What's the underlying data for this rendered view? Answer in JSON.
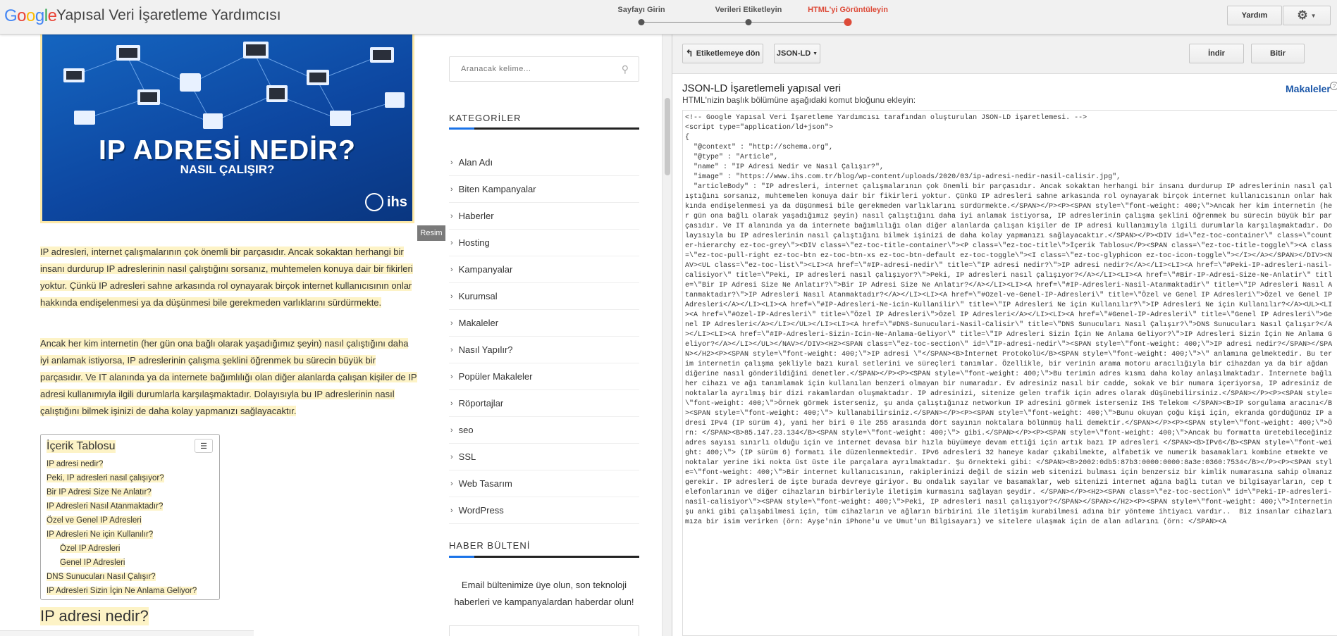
{
  "header": {
    "logo_text": "Google",
    "app_title": "Yapısal Veri İşaretleme Yardımcısı",
    "steps": [
      {
        "label": "Sayfayı Girin",
        "active": false
      },
      {
        "label": "Verileri Etiketleyin",
        "active": false
      },
      {
        "label": "HTML'yi Görüntüleyin",
        "active": true
      }
    ],
    "help_label": "Yardım",
    "colors": {
      "active_step": "#dd4b39"
    }
  },
  "preview": {
    "hero": {
      "title": "IP ADRESİ NEDİR?",
      "subtitle": "NASIL ÇALIŞIR?",
      "brand": "ihs"
    },
    "resim_label": "Resim",
    "paragraph1": "IP adresleri, internet çalışmalarının çok önemli bir parçasıdır. Ancak sokaktan herhangi bir insanı durdurup IP adreslerinin nasıl çalıştığını sorsanız, muhtemelen konuya dair bir fikirleri yoktur. Çünkü IP adresleri sahne arkasında rol oynayarak birçok internet kullanıcısının onlar hakkında endişelenmesi ya da düşünmesi bile gerekmeden varlıklarını sürdürmekte.",
    "paragraph2": "Ancak her kim internetin (her gün ona bağlı olarak yaşadığımız şeyin) nasıl çalıştığını daha iyi anlamak istiyorsa, IP adreslerinin çalışma şeklini öğrenmek bu sürecin büyük bir parçasıdır. Ve IT alanında ya da internete bağımlılığı olan diğer alanlarda çalışan kişiler de IP adresi kullanımıyla ilgili durumlarla karşılaşmaktadır. Dolayısıyla bu IP adreslerinin nasıl çalıştığını bilmek işinizi de daha kolay yapmanızı sağlayacaktır.",
    "toc": {
      "title": "İçerik Tablosu",
      "items": [
        {
          "label": "IP adresi nedir?",
          "sub": false
        },
        {
          "label": "Peki, IP adresleri nasıl çalışıyor?",
          "sub": false
        },
        {
          "label": "Bir IP Adresi Size Ne Anlatır?",
          "sub": false
        },
        {
          "label": "IP Adresleri Nasıl Atanmaktadır?",
          "sub": false
        },
        {
          "label": "Özel ve Genel IP Adresleri",
          "sub": false
        },
        {
          "label": "IP Adresleri Ne için Kullanılır?",
          "sub": false
        },
        {
          "label": "Özel IP Adresleri",
          "sub": true
        },
        {
          "label": "Genel IP Adresleri",
          "sub": true
        },
        {
          "label": "DNS Sunucuları Nasıl Çalışır?",
          "sub": false
        },
        {
          "label": "IP Adresleri Sizin İçin Ne Anlama Geliyor?",
          "sub": false
        }
      ]
    },
    "section_heading": "IP adresi nedir?",
    "sidebar": {
      "search_placeholder": "Aranacak kelime...",
      "categories_title": "KATEGORİLER",
      "categories": [
        "Alan Adı",
        "Biten Kampanyalar",
        "Haberler",
        "Hosting",
        "Kampanyalar",
        "Kurumsal",
        "Makaleler",
        "Nasıl Yapılır?",
        "Popüler Makaleler",
        "Röportajlar",
        "seo",
        "SSL",
        "Web Tasarım",
        "WordPress"
      ],
      "newsletter_title": "HABER BÜLTENİ",
      "newsletter_text": "Email bültenimize üye olun, son teknoloji haberleri ve kampanyalardan haberdar olun!"
    }
  },
  "output": {
    "back_label": "Etiketlemeye dön",
    "format_label": "JSON-LD",
    "download_label": "İndir",
    "finish_label": "Bitir",
    "title": "JSON-LD İşaretlemeli yapısal veri",
    "subtitle": "HTML'nizin başlık bölümüne aşağıdaki komut bloğunu ekleyin:",
    "articles_link": "Makaleler",
    "code": "<!-- Google Yapısal Veri İşaretleme Yardımcısı tarafından oluşturulan JSON-LD işaretlemesi. -->\n<script type=\"application/ld+json\">\n{\n  \"@context\" : \"http://schema.org\",\n  \"@type\" : \"Article\",\n  \"name\" : \"IP Adresi Nedir ve Nasıl Çalışır?\",\n  \"image\" : \"https://www.ihs.com.tr/blog/wp-content/uploads/2020/03/ip-adresi-nedir-nasil-calisir.jpg\",\n  \"articleBody\" : \"IP adresleri, internet çalışmalarının çok önemli bir parçasıdır. Ancak sokaktan herhangi bir insanı durdurup IP adreslerinin nasıl çalıştığını sorsanız, muhtemelen konuya dair bir fikirleri yoktur. Çünkü IP adresleri sahne arkasında rol oynayarak birçok internet kullanıcısının onlar hakkında endişelenmesi ya da düşünmesi bile gerekmeden varlıklarını sürdürmekte.</SPAN></P><P><SPAN style=\\\"font-weight: 400;\\\">Ancak her kim internetin (her gün ona bağlı olarak yaşadığımız şeyin) nasıl çalıştığını daha iyi anlamak istiyorsa, IP adreslerinin çalışma şeklini öğrenmek bu sürecin büyük bir parçasıdır. Ve IT alanında ya da internete bağımlılığı olan diğer alanlarda çalışan kişiler de IP adresi kullanımıyla ilgili durumlarla karşılaşmaktadır. Dolayısıyla bu IP adreslerinin nasıl çalıştığını bilmek işinizi de daha kolay yapmanızı sağlayacaktır.</SPAN></P><DIV id=\\\"ez-toc-container\\\" class=\\\"counter-hierarchy ez-toc-grey\\\"><DIV class=\\\"ez-toc-title-container\\\"><P class=\\\"ez-toc-title\\\">İçerik Tablosu</P><SPAN class=\\\"ez-toc-title-toggle\\\"><A class=\\\"ez-toc-pull-right ez-toc-btn ez-toc-btn-xs ez-toc-btn-default ez-toc-toggle\\\"><I class=\\\"ez-toc-glyphicon ez-toc-icon-toggle\\\"></I></A></SPAN></DIV><NAV><UL class=\\\"ez-toc-list\\\"><LI><A href=\\\"#IP-adresi-nedir\\\" title=\\\"IP adresi nedir?\\\">IP adresi nedir?</A></LI><LI><A href=\\\"#Peki-IP-adresleri-nasil-calisiyor\\\" title=\\\"Peki, IP adresleri nasıl çalışıyor?\\\">Peki, IP adresleri nasıl çalışıyor?</A></LI><LI><A href=\\\"#Bir-IP-Adresi-Size-Ne-Anlatir\\\" title=\\\"Bir IP Adresi Size Ne Anlatır?\\\">Bir IP Adresi Size Ne Anlatır?</A></LI><LI><A href=\\\"#IP-Adresleri-Nasil-Atanmaktadir\\\" title=\\\"IP Adresleri Nasıl Atanmaktadır?\\\">IP Adresleri Nasıl Atanmaktadır?</A></LI><LI><A href=\\\"#Ozel-ve-Genel-IP-Adresleri\\\" title=\\\"Özel ve Genel IP Adresleri\\\">Özel ve Genel IP Adresleri</A></LI><LI><A href=\\\"#IP-Adresleri-Ne-icin-Kullanilir\\\" title=\\\"IP Adresleri Ne için Kullanılır?\\\">IP Adresleri Ne için Kullanılır?</A><UL><LI><A href=\\\"#Ozel-IP-Adresleri\\\" title=\\\"Özel IP Adresleri\\\">Özel IP Adresleri</A></LI><LI><A href=\\\"#Genel-IP-Adresleri\\\" title=\\\"Genel IP Adresleri\\\">Genel IP Adresleri</A></LI></UL></LI><LI><A href=\\\"#DNS-Sunuculari-Nasil-Calisir\\\" title=\\\"DNS Sunucuları Nasıl Çalışır?\\\">DNS Sunucuları Nasıl Çalışır?</A></LI><LI><A href=\\\"#IP-Adresleri-Sizin-Icin-Ne-Anlama-Geliyor\\\" title=\\\"IP Adresleri Sizin İçin Ne Anlama Geliyor?\\\">IP Adresleri Sizin İçin Ne Anlama Geliyor?</A></LI></UL></NAV></DIV><H2><SPAN class=\\\"ez-toc-section\\\" id=\\\"IP-adresi-nedir\\\"><SPAN style=\\\"font-weight: 400;\\\">IP adresi nedir?</SPAN></SPAN></H2><P><SPAN style=\\\"font-weight: 400;\\\">IP adresi \\\"</SPAN><B>İnternet Protokolü</B><SPAN style=\\\"font-weight: 400;\\\">\\\" anlamına gelmektedir. Bu terim internetin çalışma şekliyle bazı kural setlerini ve süreçleri tanımlar. Özellikle, bir verinin arama motoru aracılığıyla bir cihazdan ya da bir ağdan diğerine nasıl gönderildiğini denetler.</SPAN></P><P><SPAN style=\\\"font-weight: 400;\\\">Bu terimin adres kısmı daha kolay anlaşılmaktadır. İnternete bağlı her cihazı ve ağı tanımlamak için kullanılan benzeri olmayan bir numaradır. Ev adresiniz nasıl bir cadde, sokak ve bir numara içeriyorsa, IP adresiniz de noktalarla ayrılmış bir dizi rakamlardan oluşmaktadır. IP adresinizi, sitenize gelen trafik için adres olarak düşünebilirsiniz.</SPAN></P><P><SPAN style=\\\"font-weight: 400;\\\">Örnek görmek isterseniz, şu anda çalıştığınız networkun IP adresini görmek isterseniz IHS Telekom </SPAN><B>IP sorgulama aracını</B><SPAN style=\\\"font-weight: 400;\\\"> kullanabilirsiniz.</SPAN></P><P><SPAN style=\\\"font-weight: 400;\\\">Bunu okuyan çoğu kişi için, ekranda gördüğünüz IP adresi IPv4 (IP sürüm 4), yani her biri 0 ile 255 arasında dört sayının noktalara bölünmüş hali demektir.</SPAN></P><P><SPAN style=\\\"font-weight: 400;\\\">Örn: </SPAN><B>85.147.23.134</B><SPAN style=\\\"font-weight: 400;\\\"> gibi.</SPAN></P><P><SPAN style=\\\"font-weight: 400;\\\">Ancak bu formatta üretebileceğiniz adres sayısı sınırlı olduğu için ve internet devasa bir hızla büyümeye devam ettiği için artık bazı IP adresleri </SPAN><B>IPv6</B><SPAN style=\\\"font-weight: 400;\\\"> (IP sürüm 6) formatı ile düzenlenmektedir. IPv6 adresleri 32 haneye kadar çıkabilmekte, alfabetik ve numerik basamakları kombine etmekte ve noktalar yerine iki nokta üst üste ile parçalara ayrılmaktadır. Şu örnekteki gibi: </SPAN><B>2002:0db5:87b3:0000:0000:8a3e:0360:7534</B></P><P><SPAN style=\\\"font-weight: 400;\\\">Bir internet kullanıcısının, rakiplerinizi değil de sizin web sitenizi bulması için benzersiz bir kimlik numarasına sahip olmanız gerekir. IP adresleri de işte burada devreye giriyor. Bu ondalık sayılar ve basamaklar, web sitenizi internet ağına bağlı tutan ve bilgisayarların, cep telefonlarının ve diğer cihazların birbirleriyle iletişim kurmasını sağlayan şeydir. </SPAN></P><H2><SPAN class=\\\"ez-toc-section\\\" id=\\\"Peki-IP-adresleri-nasil-calisiyor\\\"><SPAN style=\\\"font-weight: 400;\\\">Peki, IP adresleri nasıl çalışıyor?</SPAN></SPAN></H2><P><SPAN style=\\\"font-weight: 400;\\\">İnternetin şu anki gibi çalışabilmesi için, tüm cihazların ve ağların birbirini ile iletişim kurabilmesi adına bir yönteme ihtiyacı vardır..  Biz insanlar cihazlarımıza bir isim verirken (örn: Ayşe'nin iPhone'u ve Umut'un Bilgisayarı) ve sitelere ulaşmak için de alan adlarını (örn: </SPAN><A"
  }
}
